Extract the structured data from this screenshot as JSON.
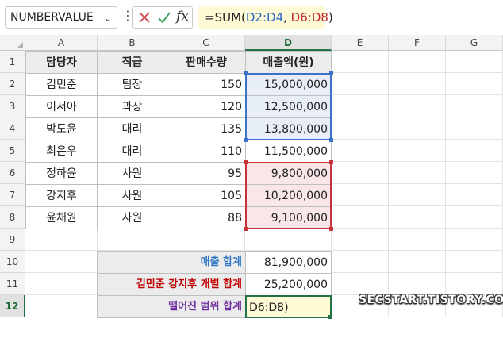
{
  "name_box": {
    "value": "NUMBERVALUE"
  },
  "formula_bar": {
    "prefix": "=SUM(",
    "ref1": "D2:D4",
    "sep": ", ",
    "ref2": "D6:D8",
    "suffix": ")"
  },
  "columns": [
    "A",
    "B",
    "C",
    "D",
    "E",
    "F",
    "G"
  ],
  "rows": [
    "1",
    "2",
    "3",
    "4",
    "5",
    "6",
    "7",
    "8",
    "9",
    "10",
    "11",
    "12"
  ],
  "table": {
    "headers": [
      "담당자",
      "직급",
      "판매수량",
      "매출액(원)"
    ],
    "rows": [
      [
        "김민준",
        "팀장",
        "150",
        "15,000,000"
      ],
      [
        "이서아",
        "과장",
        "120",
        "12,500,000"
      ],
      [
        "박도윤",
        "대리",
        "135",
        "13,800,000"
      ],
      [
        "최은우",
        "대리",
        "110",
        "11,500,000"
      ],
      [
        "정하윤",
        "사원",
        "95",
        "9,800,000"
      ],
      [
        "강지후",
        "사원",
        "105",
        "10,200,000"
      ],
      [
        "윤채원",
        "사원",
        "88",
        "9,100,000"
      ]
    ]
  },
  "summary": {
    "sales_total_label": "매출 합계",
    "sales_total_value": "81,900,000",
    "individual_label": "김민준 강지후 개별 합계",
    "individual_value": "25,200,000",
    "range_label": "떨어진 범위 합계",
    "range_editing": "D6:D8)"
  },
  "colors": {
    "accent_green": "#217346",
    "ref_blue": "#2f68c4",
    "ref_red": "#c0282d"
  },
  "watermark": "SECSTART.TISTORY.COM"
}
